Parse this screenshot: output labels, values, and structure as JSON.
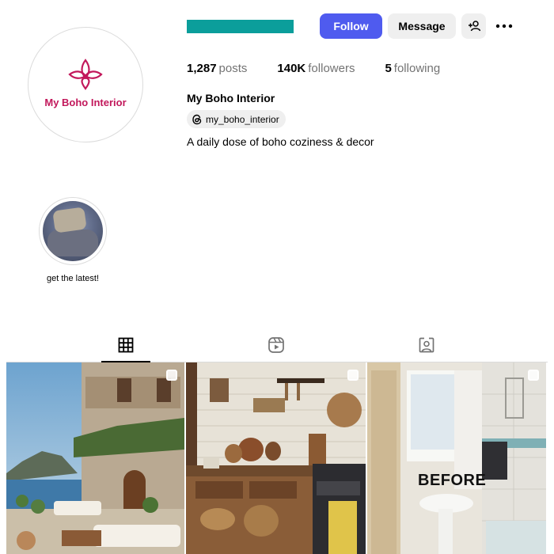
{
  "profile": {
    "avatar_text": "My Boho Interior",
    "display_name": "My Boho Interior",
    "threads_handle": "my_boho_interior",
    "bio": "A daily dose of boho coziness & decor",
    "colors": {
      "brand": "#c2185b",
      "username_redaction": "#0b9e9b",
      "follow_button": "#4f5bef"
    }
  },
  "actions": {
    "follow_label": "Follow",
    "message_label": "Message",
    "add_user_icon": "person-add-icon",
    "more_icon": "more-horizontal-icon"
  },
  "stats": {
    "posts_count": "1,287",
    "posts_label": "posts",
    "followers_count": "140K",
    "followers_label": "followers",
    "following_count": "5",
    "following_label": "following"
  },
  "highlights": [
    {
      "label": "get the latest!"
    }
  ],
  "tabs": [
    {
      "icon": "grid-icon",
      "active": true
    },
    {
      "icon": "reels-icon",
      "active": false
    },
    {
      "icon": "tagged-icon",
      "active": false
    }
  ],
  "posts": [
    {
      "subject": "seaside-stone-villa-terrace",
      "carousel": true
    },
    {
      "subject": "boho-kitchen",
      "carousel": true
    },
    {
      "subject": "bathroom-before",
      "overlay_text": "BEFORE",
      "carousel": true
    }
  ]
}
